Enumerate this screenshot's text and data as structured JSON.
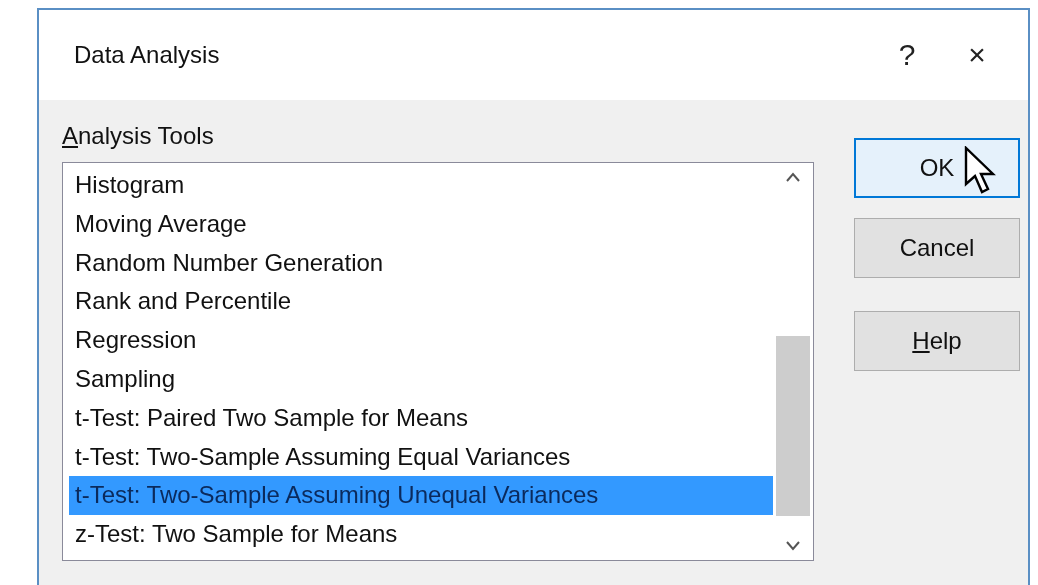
{
  "window": {
    "title": "Data Analysis",
    "help": "?",
    "close": "×"
  },
  "list_label": {
    "parts": [
      {
        "text": "A",
        "underlined": true
      },
      {
        "text": "nalysis Tools",
        "underlined": false
      }
    ]
  },
  "tools": [
    {
      "label": "Histogram",
      "selected": false
    },
    {
      "label": "Moving Average",
      "selected": false
    },
    {
      "label": "Random Number Generation",
      "selected": false
    },
    {
      "label": "Rank and Percentile",
      "selected": false
    },
    {
      "label": "Regression",
      "selected": false
    },
    {
      "label": "Sampling",
      "selected": false
    },
    {
      "label": "t-Test: Paired Two Sample for Means",
      "selected": false
    },
    {
      "label": "t-Test: Two-Sample Assuming Equal Variances",
      "selected": false
    },
    {
      "label": "t-Test: Two-Sample Assuming Unequal Variances",
      "selected": true
    },
    {
      "label": "z-Test: Two Sample for Means",
      "selected": false
    }
  ],
  "buttons": [
    {
      "label": "OK",
      "hovered": true
    },
    {
      "label": "Cancel",
      "hovered": false
    },
    {
      "parts": [
        {
          "text": "H",
          "underlined": true
        },
        {
          "text": "elp",
          "underlined": false
        }
      ],
      "hovered": false
    }
  ]
}
